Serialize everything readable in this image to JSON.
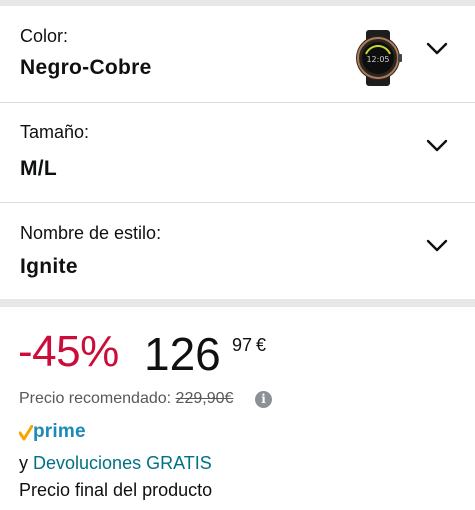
{
  "variations": {
    "color": {
      "label": "Color:",
      "value": "Negro-Cobre"
    },
    "size": {
      "label": "Tamaño:",
      "value": "M/L"
    },
    "style": {
      "label": "Nombre de estilo:",
      "value": "Ignite"
    }
  },
  "price": {
    "discount": "-45%",
    "whole": "126",
    "fraction": "97",
    "currency": "€",
    "rrp_label": "Precio recomendado:",
    "rrp_value": "229,90€",
    "info_icon_glyph": "i"
  },
  "prime": {
    "word": "prime"
  },
  "returns": {
    "prefix": "y",
    "link": "Devoluciones GRATIS"
  },
  "final_price_text": "Precio final del producto",
  "colors": {
    "discount_red": "#cc0c39",
    "link_teal": "#007185",
    "prime_blue": "#1b8ab8",
    "prime_check_orange": "#f7a500",
    "divider_grey": "#e6e8e8"
  },
  "icons": {
    "chevron": "chevron-down-icon",
    "swatch": "watch-thumbnail",
    "info": "info-icon",
    "prime_check": "prime-check-icon"
  }
}
